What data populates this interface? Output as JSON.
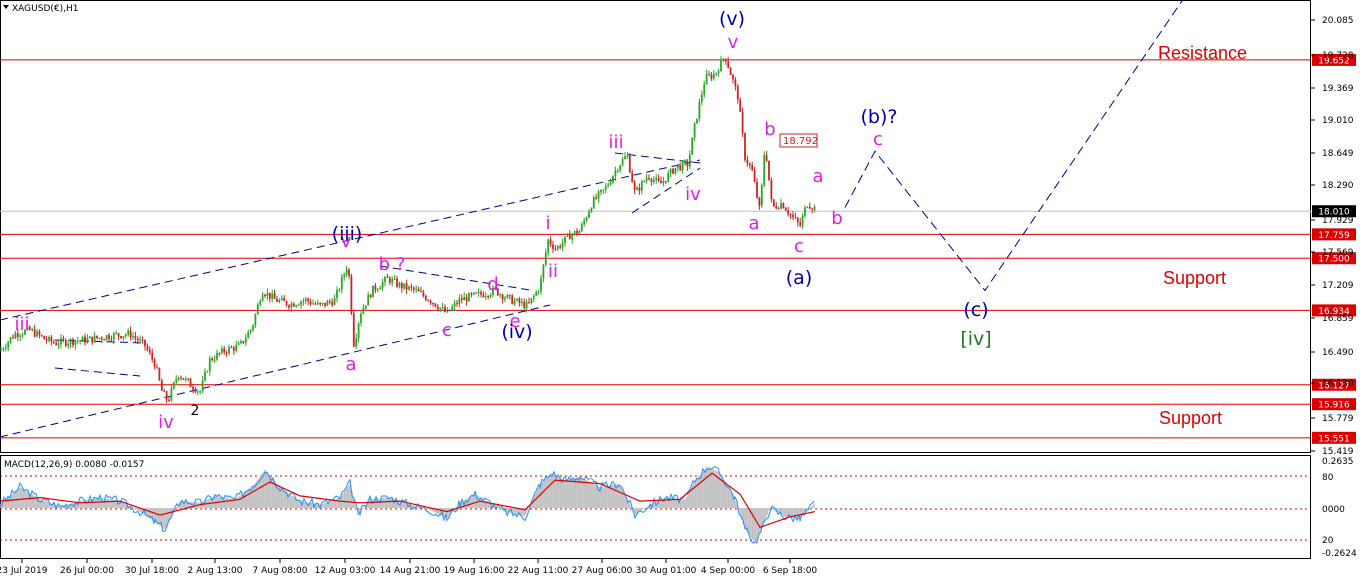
{
  "window": {
    "symbol_title": "XAGUSD(€),H1"
  },
  "colors": {
    "bull_candle": "#22aa22",
    "bear_candle": "#cc2222",
    "horizontal_level": "#dd0000",
    "channel": "#00008b",
    "wave_magenta": "#e020e0",
    "wave_blue": "#0000aa",
    "wave_green": "#227722",
    "support_text": "#dd0000",
    "macd_hist": "#c0c0c0",
    "macd_main": "#1e90ff",
    "macd_signal": "#dd0000"
  },
  "chart_data": {
    "type": "candlestick",
    "ylim": [
      15.419,
      20.085
    ],
    "price_ticks": [
      "20.085",
      "19.728",
      "19.369",
      "19.010",
      "18.649",
      "18.290",
      "17.929",
      "17.569",
      "17.209",
      "16.859",
      "16.490",
      "16.130",
      "15.779",
      "15.419"
    ],
    "time_ticks": [
      "23 Jul 2019",
      "26 Jul 00:00",
      "30 Jul 18:00",
      "2 Aug 13:00",
      "7 Aug 08:00",
      "12 Aug 03:00",
      "14 Aug 21:00",
      "19 Aug 16:00",
      "22 Aug 11:00",
      "27 Aug 06:00",
      "30 Aug 01:00",
      "4 Sep 00:00",
      "6 Sep 18:00"
    ],
    "price_path": [
      [
        0,
        16.5
      ],
      [
        15,
        16.68
      ],
      [
        30,
        16.72
      ],
      [
        45,
        16.62
      ],
      [
        55,
        16.58
      ],
      [
        70,
        16.6
      ],
      [
        90,
        16.62
      ],
      [
        110,
        16.66
      ],
      [
        130,
        16.68
      ],
      [
        145,
        16.55
      ],
      [
        155,
        16.35
      ],
      [
        162,
        16.05
      ],
      [
        168,
        15.95
      ],
      [
        178,
        16.25
      ],
      [
        188,
        16.15
      ],
      [
        200,
        16.05
      ],
      [
        210,
        16.4
      ],
      [
        225,
        16.5
      ],
      [
        240,
        16.55
      ],
      [
        252,
        16.75
      ],
      [
        262,
        17.15
      ],
      [
        275,
        17.05
      ],
      [
        290,
        17.0
      ],
      [
        305,
        17.05
      ],
      [
        320,
        16.98
      ],
      [
        335,
        17.05
      ],
      [
        348,
        17.45
      ],
      [
        354,
        16.55
      ],
      [
        360,
        16.9
      ],
      [
        372,
        17.15
      ],
      [
        388,
        17.28
      ],
      [
        400,
        17.2
      ],
      [
        415,
        17.15
      ],
      [
        430,
        17.05
      ],
      [
        447,
        16.9
      ],
      [
        460,
        17.05
      ],
      [
        478,
        17.1
      ],
      [
        495,
        17.15
      ],
      [
        510,
        17.05
      ],
      [
        528,
        16.98
      ],
      [
        540,
        17.2
      ],
      [
        548,
        17.7
      ],
      [
        556,
        17.6
      ],
      [
        570,
        17.75
      ],
      [
        580,
        17.8
      ],
      [
        592,
        18.1
      ],
      [
        605,
        18.25
      ],
      [
        618,
        18.5
      ],
      [
        627,
        18.62
      ],
      [
        635,
        18.2
      ],
      [
        648,
        18.4
      ],
      [
        660,
        18.3
      ],
      [
        675,
        18.48
      ],
      [
        688,
        18.52
      ],
      [
        695,
        18.95
      ],
      [
        705,
        19.45
      ],
      [
        715,
        19.5
      ],
      [
        725,
        19.7
      ],
      [
        738,
        19.25
      ],
      [
        745,
        18.6
      ],
      [
        752,
        18.45
      ],
      [
        760,
        18.0
      ],
      [
        765,
        18.75
      ],
      [
        772,
        18.05
      ],
      [
        782,
        18.1
      ],
      [
        792,
        17.95
      ],
      [
        800,
        17.85
      ],
      [
        807,
        18.1
      ],
      [
        815,
        18.04
      ]
    ],
    "levels": [
      {
        "value": 19.652,
        "label": "19.652"
      },
      {
        "value": 17.759,
        "label": "17.759"
      },
      {
        "value": 17.5,
        "label": "17.500"
      },
      {
        "value": 16.934,
        "label": "16.934"
      },
      {
        "value": 16.127,
        "label": "16.127"
      },
      {
        "value": 15.916,
        "label": "15.916"
      },
      {
        "value": 15.551,
        "label": "15.551"
      }
    ],
    "current_price": {
      "value": 18.01,
      "label": "18.010"
    },
    "price_callout": "18.792",
    "zone_labels": {
      "resistance": "Resistance",
      "support_upper": "Support",
      "support_lower": "Support"
    },
    "wave_labels_magenta": [
      "iii",
      "iv",
      "a",
      "v",
      "b ?",
      "c",
      "d",
      "e",
      "i",
      "ii",
      "iii",
      "iv",
      "v",
      "b",
      "a",
      "c",
      "a",
      "b",
      "c"
    ],
    "wave_labels_blue": [
      "(iii)",
      "(iv)",
      "(v)",
      "(a)",
      "(b)?",
      "(c)"
    ],
    "wave_labels_black": [
      "2"
    ],
    "wave_labels_green": [
      "[iv]"
    ],
    "projection_path": [
      [
        845,
        18.05
      ],
      [
        875,
        18.66
      ],
      [
        985,
        17.15
      ],
      [
        1195,
        20.5
      ]
    ],
    "macd": {
      "title": "MACD(12,26,9) 0.0080 -0.0157",
      "axis_ticks": [
        "0.2635",
        "80",
        "0000",
        "20",
        "-0.2624"
      ],
      "ylim": [
        -0.2624,
        0.2635
      ],
      "main_path": [
        [
          0,
          0.02
        ],
        [
          20,
          0.12
        ],
        [
          40,
          0.05
        ],
        [
          60,
          0.01
        ],
        [
          80,
          0.04
        ],
        [
          100,
          0.06
        ],
        [
          120,
          0.04
        ],
        [
          140,
          -0.02
        ],
        [
          155,
          -0.08
        ],
        [
          165,
          -0.12
        ],
        [
          180,
          0.04
        ],
        [
          200,
          0.03
        ],
        [
          215,
          0.07
        ],
        [
          235,
          0.05
        ],
        [
          255,
          0.14
        ],
        [
          265,
          0.22
        ],
        [
          280,
          0.12
        ],
        [
          300,
          0.04
        ],
        [
          320,
          0.02
        ],
        [
          340,
          0.06
        ],
        [
          350,
          0.14
        ],
        [
          358,
          -0.04
        ],
        [
          370,
          0.05
        ],
        [
          390,
          0.06
        ],
        [
          410,
          0.02
        ],
        [
          430,
          -0.01
        ],
        [
          447,
          -0.06
        ],
        [
          460,
          0.03
        ],
        [
          475,
          0.08
        ],
        [
          490,
          0.03
        ],
        [
          505,
          -0.02
        ],
        [
          525,
          -0.05
        ],
        [
          540,
          0.14
        ],
        [
          552,
          0.2
        ],
        [
          565,
          0.16
        ],
        [
          580,
          0.18
        ],
        [
          600,
          0.12
        ],
        [
          620,
          0.14
        ],
        [
          635,
          -0.04
        ],
        [
          650,
          0.02
        ],
        [
          665,
          0.06
        ],
        [
          685,
          0.05
        ],
        [
          695,
          0.16
        ],
        [
          708,
          0.24
        ],
        [
          720,
          0.2
        ],
        [
          735,
          0.06
        ],
        [
          745,
          -0.12
        ],
        [
          755,
          -0.2
        ],
        [
          762,
          -0.12
        ],
        [
          770,
          0.0
        ],
        [
          785,
          -0.05
        ],
        [
          800,
          -0.06
        ],
        [
          815,
          0.03
        ]
      ],
      "signal_path": [
        [
          0,
          0.04
        ],
        [
          40,
          0.06
        ],
        [
          80,
          0.03
        ],
        [
          120,
          0.04
        ],
        [
          160,
          -0.04
        ],
        [
          200,
          0.02
        ],
        [
          240,
          0.05
        ],
        [
          270,
          0.15
        ],
        [
          300,
          0.07
        ],
        [
          340,
          0.04
        ],
        [
          360,
          0.03
        ],
        [
          400,
          0.04
        ],
        [
          447,
          -0.02
        ],
        [
          480,
          0.04
        ],
        [
          525,
          -0.01
        ],
        [
          555,
          0.16
        ],
        [
          600,
          0.14
        ],
        [
          640,
          0.04
        ],
        [
          680,
          0.05
        ],
        [
          712,
          0.2
        ],
        [
          740,
          0.08
        ],
        [
          760,
          -0.11
        ],
        [
          790,
          -0.05
        ],
        [
          815,
          -0.02
        ]
      ]
    }
  }
}
